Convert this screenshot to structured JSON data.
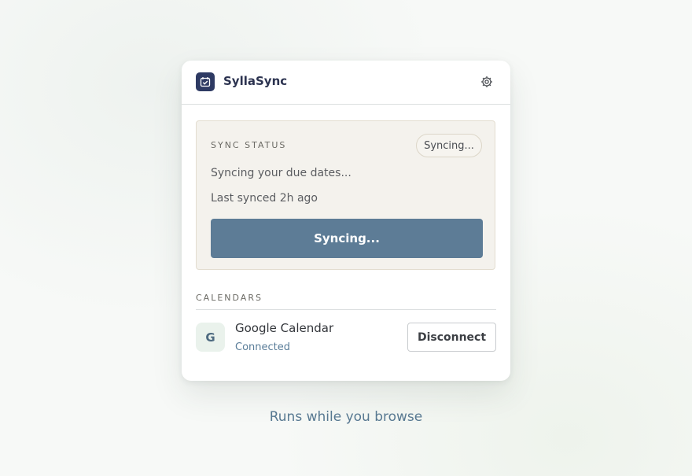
{
  "app": {
    "title": "SyllaSync",
    "logo_icon": "calendar-check-icon",
    "settings_icon": "gear-icon"
  },
  "sync_status": {
    "label": "SYNC STATUS",
    "badge": "Syncing...",
    "message": "Syncing your due dates...",
    "last_synced": "Last synced 2h ago",
    "button_label": "Syncing..."
  },
  "calendars": {
    "label": "CALENDARS",
    "items": [
      {
        "initial": "G",
        "name": "Google Calendar",
        "status": "Connected",
        "action_label": "Disconnect"
      }
    ]
  },
  "footer": {
    "tagline": "Runs while you browse"
  },
  "colors": {
    "brand": "#2e3a63",
    "primary_button": "#5d7c96",
    "status_card_bg": "#f4f2ed",
    "link_accent": "#5a7d99"
  }
}
